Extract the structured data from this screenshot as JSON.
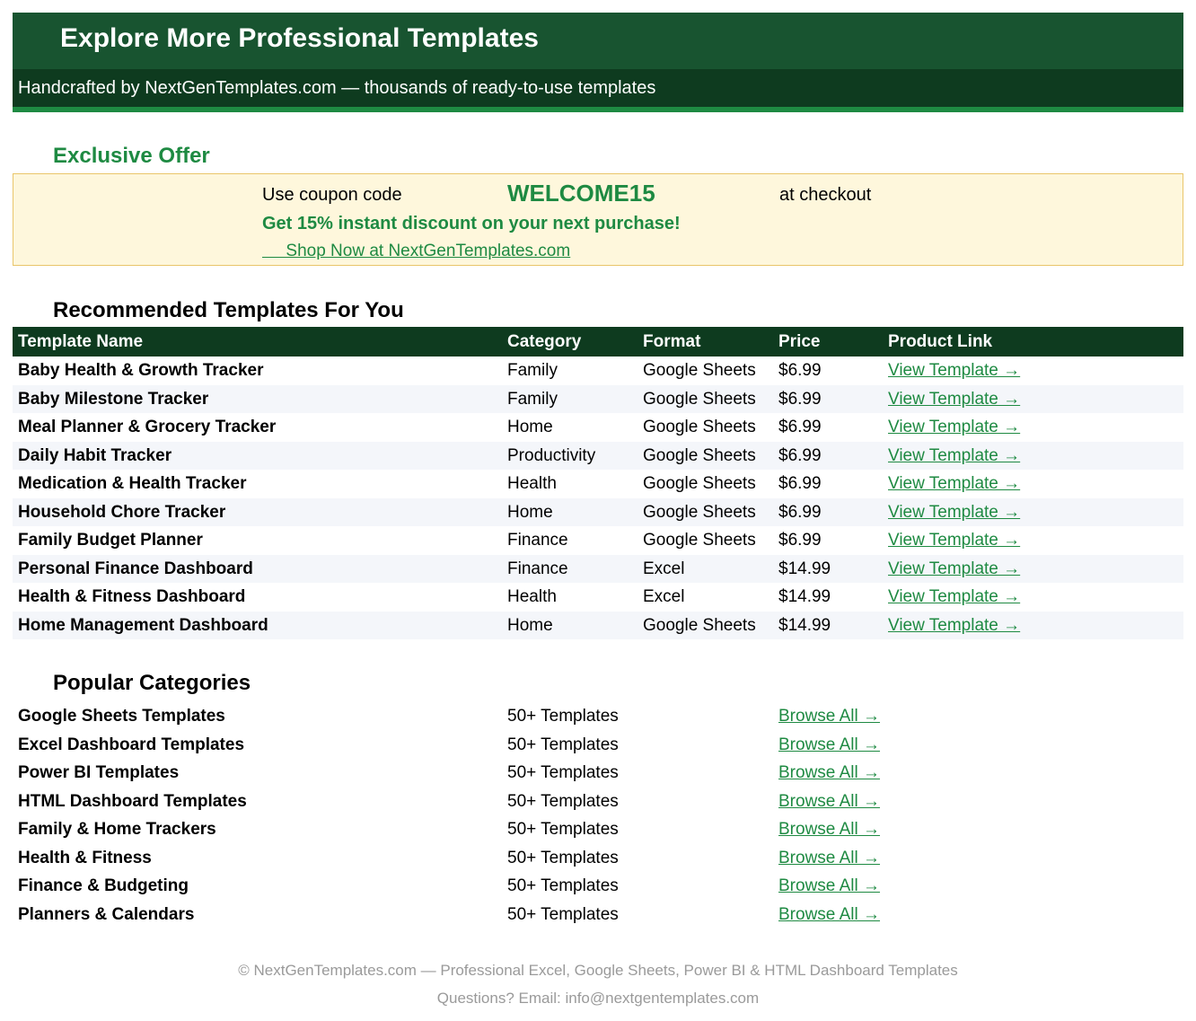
{
  "header": {
    "title": "Explore More Professional Templates",
    "subtitle": "Handcrafted by NextGenTemplates.com — thousands of ready-to-use templates"
  },
  "offer": {
    "section_title": "Exclusive Offer",
    "pre_text": "Use coupon code",
    "code": "WELCOME15",
    "post_text": "at checkout",
    "discount_text": "Get 15% instant discount on your next purchase!",
    "link_text": "     Shop Now at NextGenTemplates.com"
  },
  "recommended": {
    "section_title": "Recommended Templates For You",
    "columns": [
      "Template Name",
      "Category",
      "Format",
      "Price",
      "Product Link"
    ],
    "rows": [
      {
        "name": "Baby Health & Growth Tracker",
        "category": "Family",
        "format": "Google Sheets",
        "price": "$6.99",
        "link": "View Template →"
      },
      {
        "name": "Baby Milestone Tracker",
        "category": "Family",
        "format": "Google Sheets",
        "price": "$6.99",
        "link": "View Template →"
      },
      {
        "name": "Meal Planner & Grocery Tracker",
        "category": "Home",
        "format": "Google Sheets",
        "price": "$6.99",
        "link": "View Template →"
      },
      {
        "name": "Daily Habit Tracker",
        "category": "Productivity",
        "format": "Google Sheets",
        "price": "$6.99",
        "link": "View Template →"
      },
      {
        "name": "Medication & Health Tracker",
        "category": "Health",
        "format": "Google Sheets",
        "price": "$6.99",
        "link": "View Template →"
      },
      {
        "name": "Household Chore Tracker",
        "category": "Home",
        "format": "Google Sheets",
        "price": "$6.99",
        "link": "View Template →"
      },
      {
        "name": "Family Budget Planner",
        "category": "Finance",
        "format": "Google Sheets",
        "price": "$6.99",
        "link": "View Template →"
      },
      {
        "name": "Personal Finance Dashboard",
        "category": "Finance",
        "format": "Excel",
        "price": "$14.99",
        "link": "View Template →"
      },
      {
        "name": "Health & Fitness Dashboard",
        "category": "Health",
        "format": "Excel",
        "price": "$14.99",
        "link": "View Template →"
      },
      {
        "name": "Home Management Dashboard",
        "category": "Home",
        "format": "Google Sheets",
        "price": "$14.99",
        "link": "View Template →"
      }
    ]
  },
  "popular": {
    "section_title": "Popular Categories",
    "rows": [
      {
        "name": "Google Sheets Templates",
        "count": "50+ Templates",
        "link": "Browse All →"
      },
      {
        "name": "Excel Dashboard Templates",
        "count": "50+ Templates",
        "link": "Browse All →"
      },
      {
        "name": "Power BI Templates",
        "count": "50+ Templates",
        "link": "Browse All →"
      },
      {
        "name": "HTML Dashboard Templates",
        "count": "50+ Templates",
        "link": "Browse All →"
      },
      {
        "name": "Family & Home Trackers",
        "count": "50+ Templates",
        "link": "Browse All →"
      },
      {
        "name": "Health & Fitness",
        "count": "50+ Templates",
        "link": "Browse All →"
      },
      {
        "name": "Finance & Budgeting",
        "count": "50+ Templates",
        "link": "Browse All →"
      },
      {
        "name": "Planners & Calendars",
        "count": "50+ Templates",
        "link": "Browse All →"
      }
    ]
  },
  "footer": {
    "copyright": "© NextGenTemplates.com — Professional Excel, Google Sheets, Power BI & HTML Dashboard Templates",
    "contact": "Questions? Email: info@nextgentemplates.com"
  },
  "colors": {
    "header_bg": "#185430",
    "header_dark": "#0e3b1f",
    "accent_green": "#1e8a42",
    "offer_bg": "#fef7dc",
    "offer_border": "#e9c56a",
    "row_alt": "#f4f6fa",
    "footer_text": "#9a9a9a"
  }
}
